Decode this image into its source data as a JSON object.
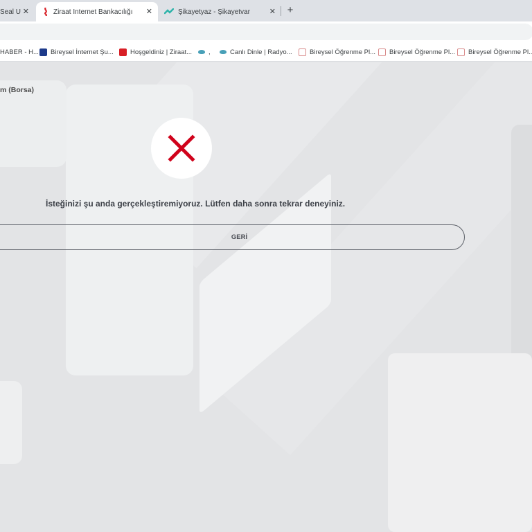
{
  "tabs": [
    {
      "title": "Seal U",
      "close": "✕"
    },
    {
      "title": "Ziraat İnternet Bankacılığı",
      "close": "✕"
    },
    {
      "title": "Şikayetyaz - Şikayetvar",
      "close": "✕"
    }
  ],
  "new_tab": "+",
  "bookmarks": [
    {
      "label": "HABER - H..."
    },
    {
      "label": "Bireysel İnternet Şu..."
    },
    {
      "label": "Hoşgeldiniz | Ziraat..."
    },
    {
      "label": ","
    },
    {
      "label": "Canlı Dinle | Radyo..."
    },
    {
      "label": "Bireysel Öğrenme Pl..."
    },
    {
      "label": "Bireysel Öğrenme Pl..."
    },
    {
      "label": "Bireysel Öğrenme Pl..."
    }
  ],
  "page": {
    "tag": "m (Borsa)",
    "message": "İsteğinizi şu anda gerçekleştiremiyoruz. Lütfen daha sonra tekrar deneyiniz.",
    "back_label": "GERİ",
    "error_color": "#d0021b"
  }
}
